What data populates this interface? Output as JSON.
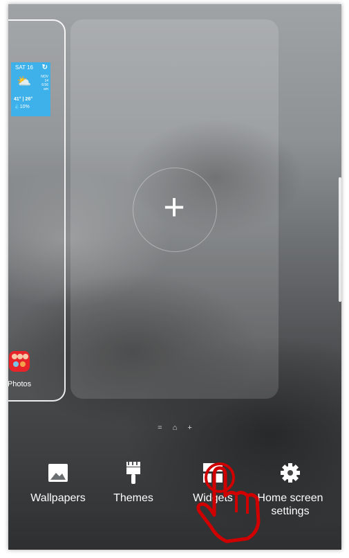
{
  "left_page": {
    "weather": {
      "day": "SAT 16",
      "side": [
        "NOV",
        "14",
        "6:56",
        "am"
      ],
      "temp": "41° | 26°",
      "rain": "10%"
    },
    "app_label": "Photos"
  },
  "indicators": {
    "list": "=",
    "home": "⌂",
    "add": "+"
  },
  "toolbar": {
    "wallpapers": "Wallpapers",
    "themes": "Themes",
    "widgets": "Widgets",
    "home_screen_settings": "Home screen settings"
  },
  "colors": {
    "weather": "#3fb1ea",
    "photos": "#e8242b",
    "pointer": "#d00000"
  }
}
